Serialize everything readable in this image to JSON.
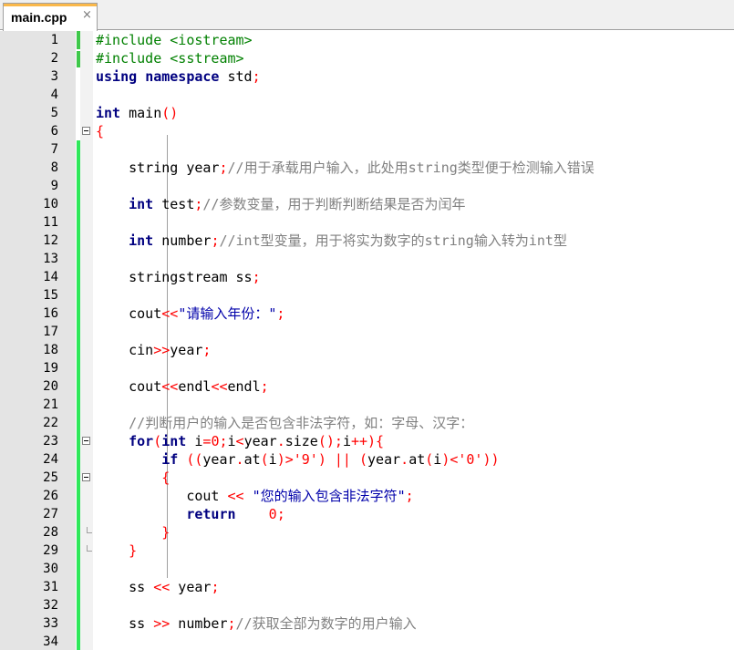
{
  "tab": {
    "label": "main.cpp",
    "close": "×"
  },
  "colors": {
    "gutter": "#e4e4e4",
    "changebar_saved": "#3ec84a",
    "changebar_modified": "#2ee85a",
    "keyword": "#000080",
    "preprocessor": "#008000",
    "comment": "#808080",
    "string": "#0000aa",
    "number": "#ff0000",
    "operator": "#ff0000"
  },
  "lines": [
    {
      "n": "1",
      "tokens": [
        [
          "pp",
          "#include <iostream>"
        ]
      ]
    },
    {
      "n": "2",
      "tokens": [
        [
          "pp",
          "#include <sstream>"
        ]
      ]
    },
    {
      "n": "3",
      "tokens": [
        [
          "kw",
          "using"
        ],
        [
          "pl",
          " "
        ],
        [
          "kw",
          "namespace"
        ],
        [
          "pl",
          " std"
        ],
        [
          "op",
          ";"
        ]
      ]
    },
    {
      "n": "4",
      "tokens": []
    },
    {
      "n": "5",
      "tokens": [
        [
          "kw",
          "int"
        ],
        [
          "pl",
          " main"
        ],
        [
          "op",
          "()"
        ]
      ]
    },
    {
      "n": "6",
      "tokens": [
        [
          "op",
          "{"
        ]
      ]
    },
    {
      "n": "7",
      "tokens": []
    },
    {
      "n": "8",
      "tokens": [
        [
          "pl",
          "    string year"
        ],
        [
          "op",
          ";"
        ],
        [
          "cm",
          "//用于承载用户输入，此处用string类型便于检测输入错误"
        ]
      ]
    },
    {
      "n": "9",
      "tokens": []
    },
    {
      "n": "10",
      "tokens": [
        [
          "pl",
          "    "
        ],
        [
          "kw",
          "int"
        ],
        [
          "pl",
          " test"
        ],
        [
          "op",
          ";"
        ],
        [
          "cm",
          "//参数变量，用于判断判断结果是否为闰年"
        ]
      ]
    },
    {
      "n": "11",
      "tokens": []
    },
    {
      "n": "12",
      "tokens": [
        [
          "pl",
          "    "
        ],
        [
          "kw",
          "int"
        ],
        [
          "pl",
          " number"
        ],
        [
          "op",
          ";"
        ],
        [
          "cm",
          "//int型变量，用于将实为数字的string输入转为int型"
        ]
      ]
    },
    {
      "n": "13",
      "tokens": []
    },
    {
      "n": "14",
      "tokens": [
        [
          "pl",
          "    stringstream ss"
        ],
        [
          "op",
          ";"
        ]
      ]
    },
    {
      "n": "15",
      "tokens": []
    },
    {
      "n": "16",
      "tokens": [
        [
          "pl",
          "    cout"
        ],
        [
          "op",
          "<<"
        ],
        [
          "st",
          "\"请输入年份：\""
        ],
        [
          "op",
          ";"
        ]
      ]
    },
    {
      "n": "17",
      "tokens": []
    },
    {
      "n": "18",
      "tokens": [
        [
          "pl",
          "    cin"
        ],
        [
          "op",
          ">>"
        ],
        [
          "pl",
          "year"
        ],
        [
          "op",
          ";"
        ]
      ]
    },
    {
      "n": "19",
      "tokens": []
    },
    {
      "n": "20",
      "tokens": [
        [
          "pl",
          "    cout"
        ],
        [
          "op",
          "<<"
        ],
        [
          "pl",
          "endl"
        ],
        [
          "op",
          "<<"
        ],
        [
          "pl",
          "endl"
        ],
        [
          "op",
          ";"
        ]
      ]
    },
    {
      "n": "21",
      "tokens": []
    },
    {
      "n": "22",
      "tokens": [
        [
          "pl",
          "    "
        ],
        [
          "cm",
          "//判断用户的输入是否包含非法字符，如：字母、汉字："
        ]
      ]
    },
    {
      "n": "23",
      "tokens": [
        [
          "pl",
          "    "
        ],
        [
          "kw",
          "for"
        ],
        [
          "op",
          "("
        ],
        [
          "kw",
          "int"
        ],
        [
          "pl",
          " i"
        ],
        [
          "op",
          "="
        ],
        [
          "nm",
          "0"
        ],
        [
          "op",
          ";"
        ],
        [
          "pl",
          "i"
        ],
        [
          "op",
          "<"
        ],
        [
          "pl",
          "year"
        ],
        [
          "op",
          "."
        ],
        [
          "pl",
          "size"
        ],
        [
          "op",
          "();"
        ],
        [
          "pl",
          "i"
        ],
        [
          "op",
          "++){"
        ]
      ]
    },
    {
      "n": "24",
      "tokens": [
        [
          "pl",
          "        "
        ],
        [
          "kw",
          "if"
        ],
        [
          "pl",
          " "
        ],
        [
          "op",
          "(("
        ],
        [
          "pl",
          "year"
        ],
        [
          "op",
          "."
        ],
        [
          "pl",
          "at"
        ],
        [
          "op",
          "("
        ],
        [
          "pl",
          "i"
        ],
        [
          "op",
          ")>"
        ],
        [
          "nm",
          "'9'"
        ],
        [
          "op",
          ")"
        ],
        [
          "pl",
          " "
        ],
        [
          "op",
          "||"
        ],
        [
          "pl",
          " "
        ],
        [
          "op",
          "("
        ],
        [
          "pl",
          "year"
        ],
        [
          "op",
          "."
        ],
        [
          "pl",
          "at"
        ],
        [
          "op",
          "("
        ],
        [
          "pl",
          "i"
        ],
        [
          "op",
          ")<"
        ],
        [
          "nm",
          "'0'"
        ],
        [
          "op",
          "))"
        ]
      ]
    },
    {
      "n": "25",
      "tokens": [
        [
          "pl",
          "        "
        ],
        [
          "op",
          "{"
        ]
      ]
    },
    {
      "n": "26",
      "tokens": [
        [
          "pl",
          "           cout "
        ],
        [
          "op",
          "<<"
        ],
        [
          "pl",
          " "
        ],
        [
          "st",
          "\"您的输入包含非法字符\""
        ],
        [
          "op",
          ";"
        ]
      ]
    },
    {
      "n": "27",
      "tokens": [
        [
          "pl",
          "           "
        ],
        [
          "kw",
          "return"
        ],
        [
          "pl",
          "    "
        ],
        [
          "nm",
          "0"
        ],
        [
          "op",
          ";"
        ]
      ]
    },
    {
      "n": "28",
      "tokens": [
        [
          "pl",
          "        "
        ],
        [
          "op",
          "}"
        ]
      ]
    },
    {
      "n": "29",
      "tokens": [
        [
          "pl",
          "    "
        ],
        [
          "op",
          "}"
        ]
      ]
    },
    {
      "n": "30",
      "tokens": []
    },
    {
      "n": "31",
      "tokens": [
        [
          "pl",
          "    ss "
        ],
        [
          "op",
          "<<"
        ],
        [
          "pl",
          " year"
        ],
        [
          "op",
          ";"
        ]
      ]
    },
    {
      "n": "32",
      "tokens": []
    },
    {
      "n": "33",
      "tokens": [
        [
          "pl",
          "    ss "
        ],
        [
          "op",
          ">>"
        ],
        [
          "pl",
          " number"
        ],
        [
          "op",
          ";"
        ],
        [
          "cm",
          "//获取全部为数字的用户输入"
        ]
      ]
    },
    {
      "n": "34",
      "tokens": []
    }
  ]
}
